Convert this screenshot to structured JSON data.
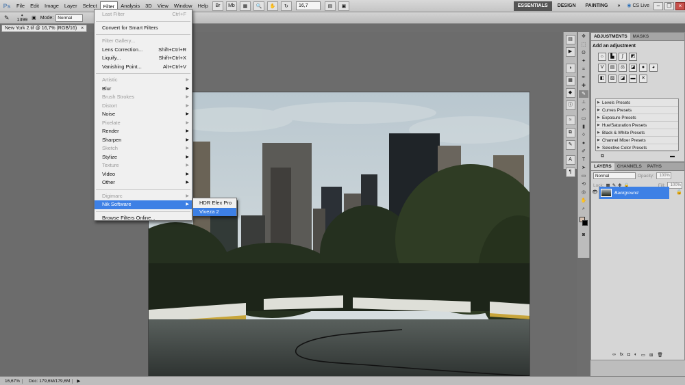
{
  "menubar": {
    "logo": "Ps",
    "items": [
      "File",
      "Edit",
      "Image",
      "Layer",
      "Select",
      "Filter",
      "Analysis",
      "3D",
      "View",
      "Window",
      "Help"
    ],
    "active_item": "Filter",
    "zoom": "16,7",
    "workspaces": [
      "ESSENTIALS",
      "DESIGN",
      "PAINTING",
      "»"
    ],
    "active_workspace": "ESSENTIALS",
    "cslive": "CS Live"
  },
  "options": {
    "brush_size": "1399",
    "mode_label": "Mode:",
    "mode_value": "Normal"
  },
  "document_tab": {
    "title": "New York 2.tif @ 16,7% (RGB/16)",
    "close": "×"
  },
  "filter_menu": {
    "items": [
      {
        "label": "Last Filter",
        "shortcut": "Ctrl+F",
        "disabled": true
      },
      {
        "sep": true
      },
      {
        "label": "Convert for Smart Filters"
      },
      {
        "sep": true
      },
      {
        "label": "Filter Gallery...",
        "disabled": true
      },
      {
        "label": "Lens Correction...",
        "shortcut": "Shift+Ctrl+R"
      },
      {
        "label": "Liquify...",
        "shortcut": "Shift+Ctrl+X"
      },
      {
        "label": "Vanishing Point...",
        "shortcut": "Alt+Ctrl+V"
      },
      {
        "sep": true
      },
      {
        "label": "Artistic",
        "disabled": true,
        "submenu": true
      },
      {
        "label": "Blur",
        "submenu": true
      },
      {
        "label": "Brush Strokes",
        "disabled": true,
        "submenu": true
      },
      {
        "label": "Distort",
        "disabled": true,
        "submenu": true
      },
      {
        "label": "Noise",
        "submenu": true
      },
      {
        "label": "Pixelate",
        "disabled": true,
        "submenu": true
      },
      {
        "label": "Render",
        "submenu": true
      },
      {
        "label": "Sharpen",
        "submenu": true
      },
      {
        "label": "Sketch",
        "disabled": true,
        "submenu": true
      },
      {
        "label": "Stylize",
        "submenu": true
      },
      {
        "label": "Texture",
        "disabled": true,
        "submenu": true
      },
      {
        "label": "Video",
        "submenu": true
      },
      {
        "label": "Other",
        "submenu": true
      },
      {
        "sep": true
      },
      {
        "label": "Digimarc",
        "disabled": true,
        "submenu": true
      },
      {
        "label": "Nik Software",
        "submenu": true,
        "highlight": true
      },
      {
        "sep": true
      },
      {
        "label": "Browse Filters Online..."
      }
    ]
  },
  "submenu": {
    "items": [
      {
        "label": "HDR Efex Pro"
      },
      {
        "label": "Viveza 2",
        "highlight": true
      }
    ]
  },
  "adjustments": {
    "tabs": [
      "ADJUSTMENTS",
      "MASKS"
    ],
    "title": "Add an adjustment",
    "presets": [
      "Levels Presets",
      "Curves Presets",
      "Exposure Presets",
      "Hue/Saturation Presets",
      "Black & White Presets",
      "Channel Mixer Presets",
      "Selective Color Presets"
    ]
  },
  "layers": {
    "tabs": [
      "LAYERS",
      "CHANNELS",
      "PATHS"
    ],
    "blend_mode": "Normal",
    "opacity_label": "Opacity:",
    "opacity_value": "100%",
    "lock_label": "Lock:",
    "fill_label": "Fill:",
    "fill_value": "100%",
    "layer_name": "Background"
  },
  "status": {
    "zoom": "16,67%",
    "doc": "Doc: 179,6M/179,6M"
  },
  "colors": {
    "highlight": "#3d80e5",
    "foreground": "#d7c2b2",
    "background": "#000000"
  }
}
